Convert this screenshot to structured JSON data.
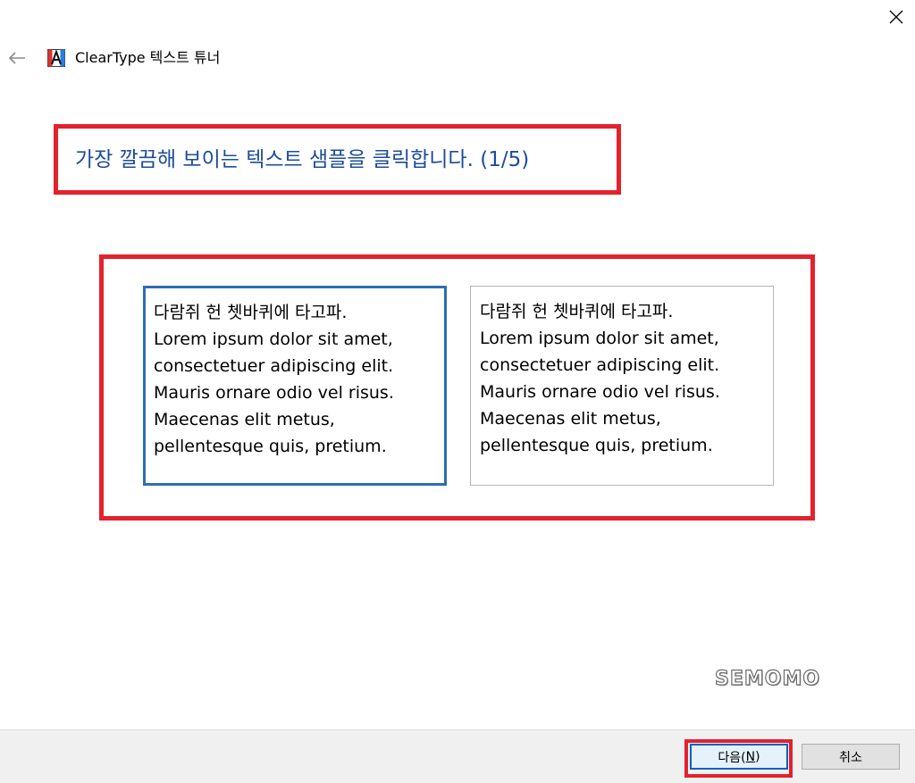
{
  "window": {
    "title": "ClearType 텍스트 튜너",
    "icons": {
      "back": "back-arrow-icon",
      "app": "cleartype-app-icon",
      "close": "close-icon"
    }
  },
  "instruction": "가장 깔끔해 보이는 텍스트 샘플을 클릭합니다. (1/5)",
  "samples": [
    {
      "selected": true,
      "lines": [
        "다람쥐 헌 쳇바퀴에 타고파.",
        "Lorem ipsum dolor sit amet,",
        "consectetuer adipiscing elit.",
        "Mauris ornare odio vel risus.",
        "Maecenas elit metus,",
        "pellentesque quis, pretium."
      ]
    },
    {
      "selected": false,
      "lines": [
        "다람쥐 헌 쳇바퀴에 타고파.",
        "Lorem ipsum dolor sit amet,",
        "consectetuer adipiscing elit.",
        "Mauris ornare odio vel risus.",
        "Maecenas elit metus,",
        "pellentesque quis, pretium."
      ]
    }
  ],
  "watermark": "SEMOMO",
  "buttons": {
    "next_label": "다음(",
    "next_accel": "N",
    "next_suffix": ")",
    "cancel_label": "취소"
  },
  "colors": {
    "highlight": "#e3222d",
    "instruction_text": "#1d4c9a",
    "selected_border": "#2d6db3"
  }
}
